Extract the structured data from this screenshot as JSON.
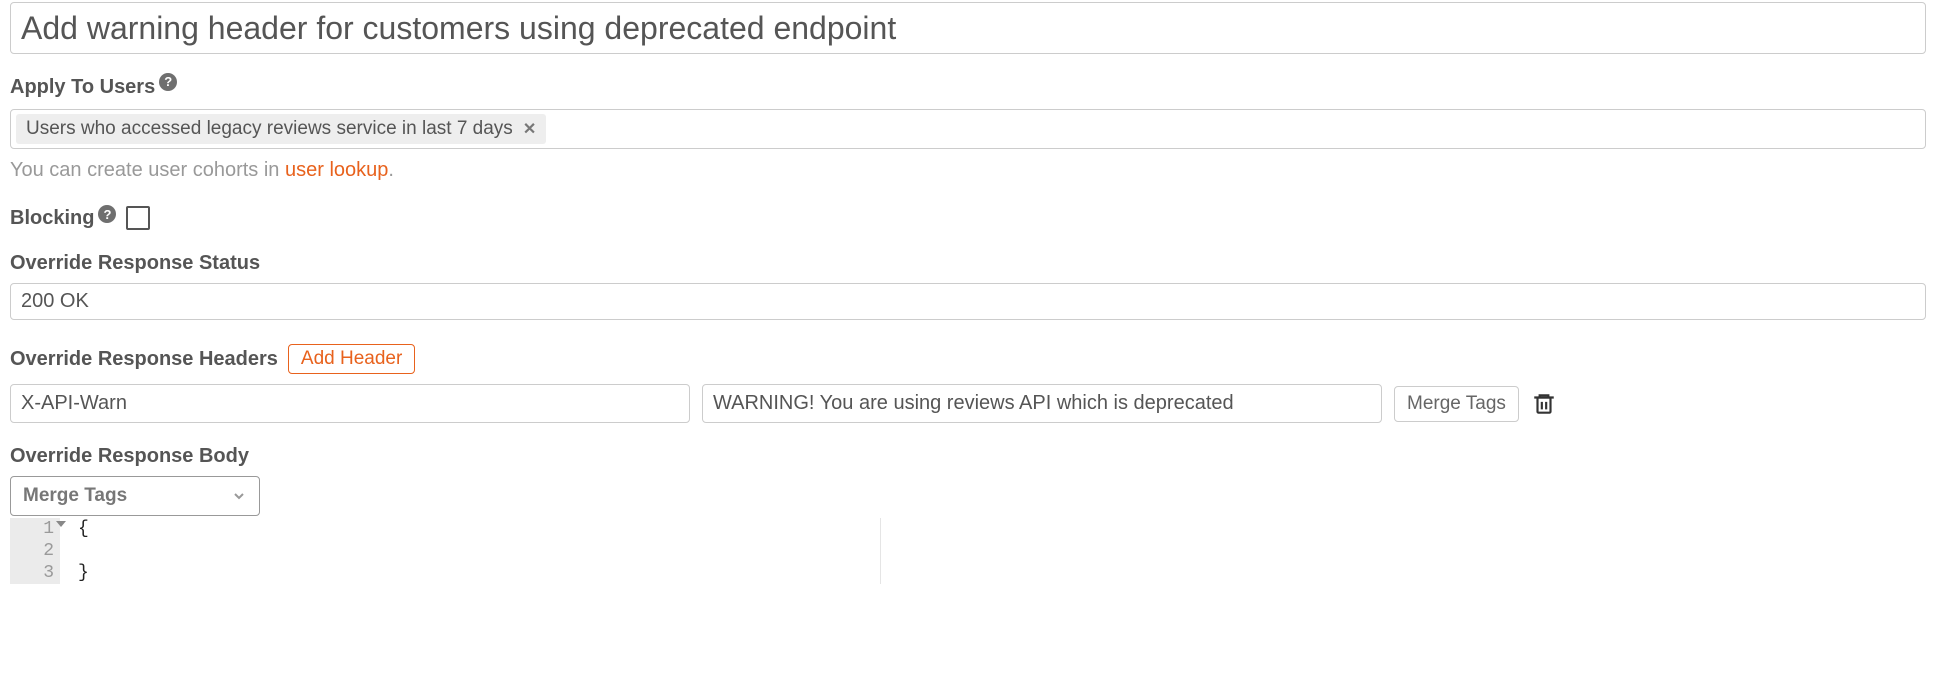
{
  "title": "Add warning header for customers using deprecated endpoint",
  "applyToUsers": {
    "label": "Apply To Users",
    "chips": [
      {
        "text": "Users who accessed legacy reviews service in last 7 days"
      }
    ],
    "hint_prefix": "You can create user cohorts in ",
    "hint_link": "user lookup",
    "hint_suffix": "."
  },
  "blocking": {
    "label": "Blocking"
  },
  "overrideStatus": {
    "label": "Override Response Status",
    "value": "200 OK"
  },
  "overrideHeaders": {
    "label": "Override Response Headers",
    "addButton": "Add Header",
    "rows": [
      {
        "key": "X-API-Warn",
        "value": "WARNING! You are using reviews API which is deprecated"
      }
    ],
    "mergeTags": "Merge Tags"
  },
  "overrideBody": {
    "label": "Override Response Body",
    "mergeSelect": "Merge Tags",
    "gutter": [
      "1",
      "2",
      "3"
    ],
    "lines": [
      "{",
      "",
      "}"
    ]
  }
}
